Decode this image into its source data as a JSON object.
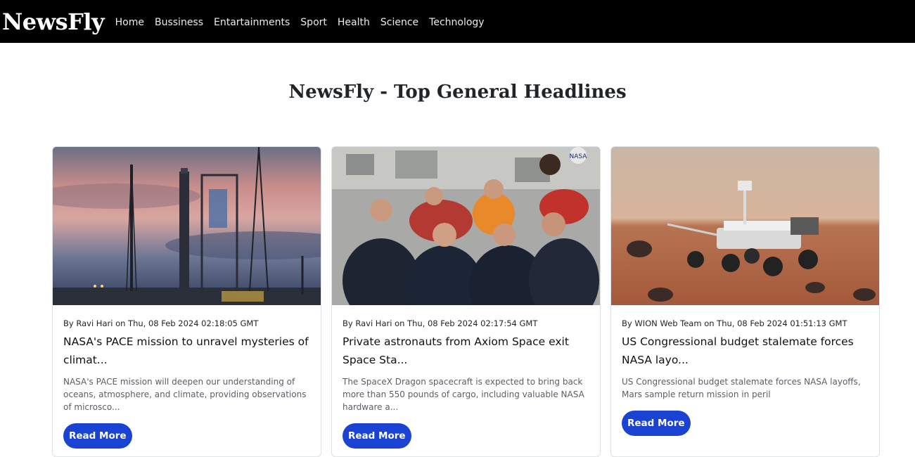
{
  "nav": {
    "brand": "NewsFly",
    "links": [
      "Home",
      "Bussiness",
      "Entartainments",
      "Sport",
      "Health",
      "Science",
      "Technology"
    ]
  },
  "main": {
    "headline": "NewsFly - Top General Headlines"
  },
  "cards": [
    {
      "image_alt": "Rocket launch pad at sunset",
      "byline": "By Ravi Hari on Thu, 08 Feb 2024 02:18:05 GMT",
      "title": "NASA's PACE mission to unravel mysteries of climat...",
      "description": "NASA's PACE mission will deepen our understanding of oceans, atmosphere, and climate, providing observations of microsco...",
      "button": "Read More"
    },
    {
      "image_alt": "Astronauts waving inside space station",
      "byline": "By Ravi Hari on Thu, 08 Feb 2024 02:17:54 GMT",
      "title": "Private astronauts from Axiom Space exit Space Sta...",
      "description": "The SpaceX Dragon spacecraft is expected to bring back more than 550 pounds of cargo, including valuable NASA hardware a...",
      "button": "Read More"
    },
    {
      "image_alt": "Mars rover on red terrain",
      "byline": "By WION Web Team on Thu, 08 Feb 2024 01:51:13 GMT",
      "title": "US Congressional budget stalemate forces NASA layo...",
      "description": "US Congressional budget stalemate forces NASA layoffs, Mars sample return mission in peril",
      "button": "Read More"
    }
  ]
}
